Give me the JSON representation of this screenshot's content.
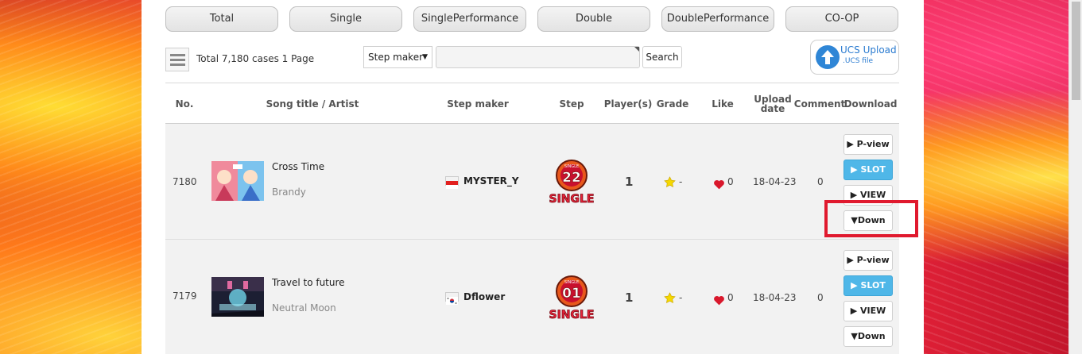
{
  "tabs": [
    "Total",
    "Single",
    "SinglePerformance",
    "Double",
    "DoublePerformance",
    "CO-OP"
  ],
  "toolbar": {
    "total_text": "Total 7,180 cases 1 Page",
    "select_value": "Step maker",
    "search_value": "",
    "search_label": "Search",
    "ucs_title": "UCS Upload",
    "ucs_sub": ".UCS file"
  },
  "headers": {
    "no": "No.",
    "song": "Song title / Artist",
    "maker": "Step maker",
    "step": "Step",
    "players": "Player(s)",
    "grade": "Grade",
    "like": "Like",
    "upload_a": "Upload",
    "upload_b": "date",
    "comment": "Comment",
    "download": "Download"
  },
  "rows": [
    {
      "no": "7180",
      "title": "Cross Time",
      "artist": "Brandy",
      "maker": "MYSTER_Y",
      "step_label": "SINGLE",
      "step_level": "22",
      "players": "1",
      "grade": "-",
      "likes": "0",
      "date": "18-04-23",
      "comments": "0",
      "flag": "indonesia-flag"
    },
    {
      "no": "7179",
      "title": "Travel to future",
      "artist": "Neutral Moon",
      "maker": "Dflower",
      "step_label": "SINGLE",
      "step_level": "01",
      "players": "1",
      "grade": "-",
      "likes": "0",
      "date": "18-04-23",
      "comments": "0",
      "flag": "south-korea-flag"
    }
  ],
  "actions": {
    "pview": "▶ P-view",
    "slot": "▶ SLOT",
    "view": "▶ VIEW",
    "down": "▼Down"
  },
  "colors": {
    "highlight": "#e0192e",
    "slot": "#4fb7e8",
    "step_orange": "#e8581c",
    "step_red": "#c8102e"
  }
}
